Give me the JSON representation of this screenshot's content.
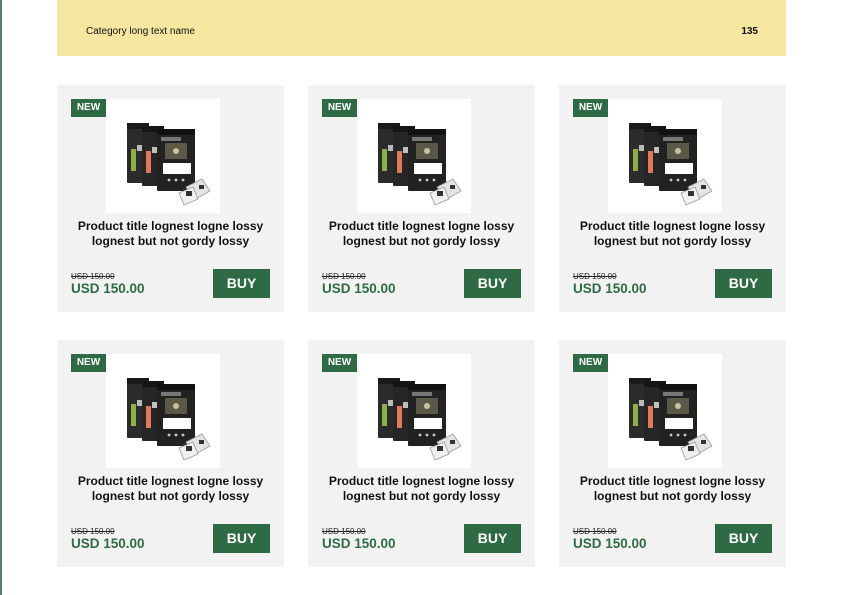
{
  "header": {
    "title": "Category long text name",
    "page_number": "135"
  },
  "colors": {
    "header_bg": "#f5e6a0",
    "accent_green": "#2e6b45",
    "card_bg": "#f2f2f2"
  },
  "products": [
    {
      "badge": "NEW",
      "title_line1": "Product title lognest logne lossy",
      "title_line2": "lognest but not gordy lossy",
      "old_price": "USD 150.00",
      "price": "USD 150.00",
      "buy_label": "BUY",
      "image_icon": "coffee-bags-icon"
    },
    {
      "badge": "NEW",
      "title_line1": "Product title lognest logne lossy",
      "title_line2": "lognest but not gordy lossy",
      "old_price": "USD 150.00",
      "price": "USD 150.00",
      "buy_label": "BUY",
      "image_icon": "coffee-bags-icon"
    },
    {
      "badge": "NEW",
      "title_line1": "Product title lognest logne lossy",
      "title_line2": "lognest but not gordy lossy",
      "old_price": "USD 150.00",
      "price": "USD 150.00",
      "buy_label": "BUY",
      "image_icon": "coffee-bags-icon"
    },
    {
      "badge": "NEW",
      "title_line1": "Product title lognest logne lossy",
      "title_line2": "lognest but not gordy lossy",
      "old_price": "USD 150.00",
      "price": "USD 150.00",
      "buy_label": "BUY",
      "image_icon": "coffee-bags-icon"
    },
    {
      "badge": "NEW",
      "title_line1": "Product title lognest logne lossy",
      "title_line2": "lognest but not gordy lossy",
      "old_price": "USD 150.00",
      "price": "USD 150.00",
      "buy_label": "BUY",
      "image_icon": "coffee-bags-icon"
    },
    {
      "badge": "NEW",
      "title_line1": "Product title lognest logne lossy",
      "title_line2": "lognest but not gordy lossy",
      "old_price": "USD 150.00",
      "price": "USD 150.00",
      "buy_label": "BUY",
      "image_icon": "coffee-bags-icon"
    }
  ]
}
